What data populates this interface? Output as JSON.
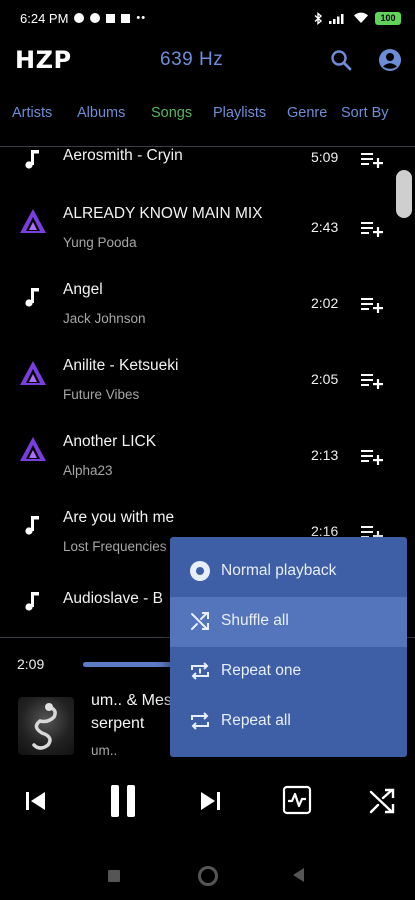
{
  "status_bar": {
    "time": "6:24 PM",
    "dots": "••",
    "battery": "100"
  },
  "header": {
    "logo": "HZP",
    "frequency": "639 Hz"
  },
  "tabs": [
    {
      "label": "Artists"
    },
    {
      "label": "Albums"
    },
    {
      "label": "Songs",
      "active": true
    },
    {
      "label": "Playlists"
    },
    {
      "label": "Genre"
    },
    {
      "label": "Sort By"
    }
  ],
  "songs": [
    {
      "title": "Aerosmith - Cryin",
      "artist": "",
      "duration": "5:09",
      "icon": "music-note-icon"
    },
    {
      "title": "ALREADY KNOW MAIN MIX",
      "artist": "Yung Pooda",
      "duration": "2:43",
      "icon": "triangle-logo-icon"
    },
    {
      "title": "Angel",
      "artist": "Jack Johnson",
      "duration": "2:02",
      "icon": "music-note-icon"
    },
    {
      "title": "Anilite - Ketsueki",
      "artist": "Future Vibes",
      "duration": "2:05",
      "icon": "triangle-logo-icon"
    },
    {
      "title": "Another LICK",
      "artist": "Alpha23",
      "duration": "2:13",
      "icon": "triangle-logo-icon"
    },
    {
      "title": "Are you with me",
      "artist": "Lost Frequencies",
      "duration": "2:16",
      "icon": "music-note-icon"
    },
    {
      "title": "Audioslave - B",
      "artist": "",
      "duration": "",
      "icon": "music-note-icon"
    }
  ],
  "player": {
    "elapsed": "2:09",
    "progress": 0.3,
    "title_line1": "um.. & Mes",
    "title_line2": "serpent",
    "artist": "um.."
  },
  "playback_menu": {
    "items": [
      {
        "label": "Normal playback",
        "icon": "record-icon"
      },
      {
        "label": "Shuffle all",
        "icon": "shuffle-icon",
        "highlighted": true
      },
      {
        "label": "Repeat one",
        "icon": "repeat-one-icon"
      },
      {
        "label": "Repeat all",
        "icon": "repeat-icon"
      }
    ]
  },
  "colors": {
    "accent_blue": "#6d8ed6",
    "active_tab_green": "#57b65a",
    "menu_bg": "#3e5ea6",
    "menu_highlight": "#5474bc",
    "triangle_purple": "#7a3de0"
  }
}
